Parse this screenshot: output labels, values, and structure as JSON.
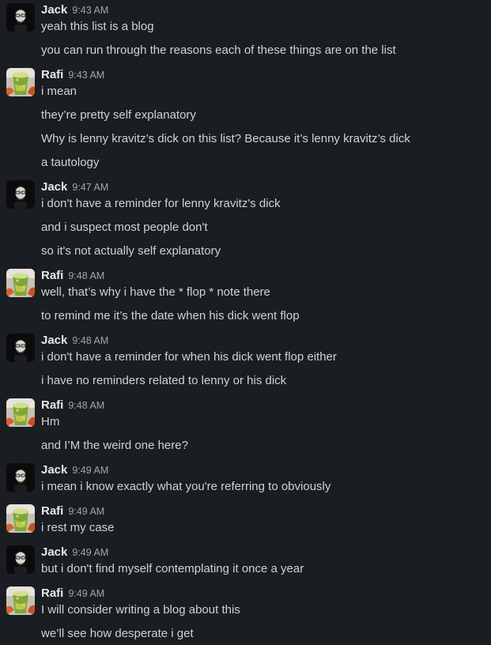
{
  "groups": [
    {
      "author": "Jack",
      "avatar": "jack-avatar",
      "time": "9:43 AM",
      "messages": [
        "yeah this list is a blog",
        "you can run through the reasons each of these things are on the list"
      ]
    },
    {
      "author": "Rafi",
      "avatar": "rafi-avatar",
      "time": "9:43 AM",
      "messages": [
        "i mean",
        "they’re pretty self explanatory",
        "Why is lenny kravitz’s dick on this list? Because it’s lenny kravitz’s dick",
        "a tautology"
      ]
    },
    {
      "author": "Jack",
      "avatar": "jack-avatar",
      "time": "9:47 AM",
      "messages": [
        "i don't have a reminder for lenny kravitz's dick",
        "and i suspect most people don't",
        "so it's not actually self explanatory"
      ]
    },
    {
      "author": "Rafi",
      "avatar": "rafi-avatar",
      "time": "9:48 AM",
      "messages": [
        "well, that’s why i have the * flop * note there",
        "to remind me it’s the date when his dick went flop"
      ]
    },
    {
      "author": "Jack",
      "avatar": "jack-avatar",
      "time": "9:48 AM",
      "messages": [
        "i don't have a reminder for when his dick went flop either",
        "i have no reminders related to lenny or his dick"
      ]
    },
    {
      "author": "Rafi",
      "avatar": "rafi-avatar",
      "time": "9:48 AM",
      "messages": [
        "Hm",
        "and I’M the weird one here?"
      ]
    },
    {
      "author": "Jack",
      "avatar": "jack-avatar",
      "time": "9:49 AM",
      "messages": [
        "i mean i know exactly what you're referring to obviously"
      ]
    },
    {
      "author": "Rafi",
      "avatar": "rafi-avatar",
      "time": "9:49 AM",
      "messages": [
        "i rest my case"
      ]
    },
    {
      "author": "Jack",
      "avatar": "jack-avatar",
      "time": "9:49 AM",
      "messages": [
        "but i don't find myself contemplating it once a year"
      ]
    },
    {
      "author": "Rafi",
      "avatar": "rafi-avatar",
      "time": "9:49 AM",
      "messages": [
        "I will consider writing a blog about this",
        "we’ll see how desperate i get"
      ]
    }
  ]
}
